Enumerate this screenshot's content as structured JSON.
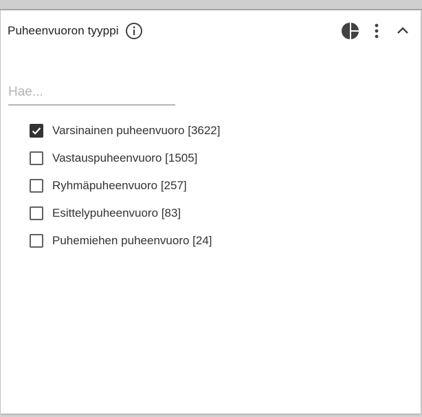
{
  "filter": {
    "title": "Puheenvuoron tyyppi",
    "search_placeholder": "Hae...",
    "options": [
      {
        "label": "Varsinainen puheenvuoro [3622]",
        "checked": true
      },
      {
        "label": "Vastauspuheenvuoro [1505]",
        "checked": false
      },
      {
        "label": "Ryhmäpuheenvuoro [257]",
        "checked": false
      },
      {
        "label": "Esittelypuheenvuoro [83]",
        "checked": false
      },
      {
        "label": "Puhemiehen puheenvuoro [24]",
        "checked": false
      }
    ]
  },
  "icons": {
    "info": "info-icon",
    "chart": "pie-chart-icon",
    "menu": "more-vert-icon",
    "collapse": "chevron-up-icon"
  },
  "colors": {
    "checkbox_checked": "#333333",
    "text": "#212121"
  }
}
